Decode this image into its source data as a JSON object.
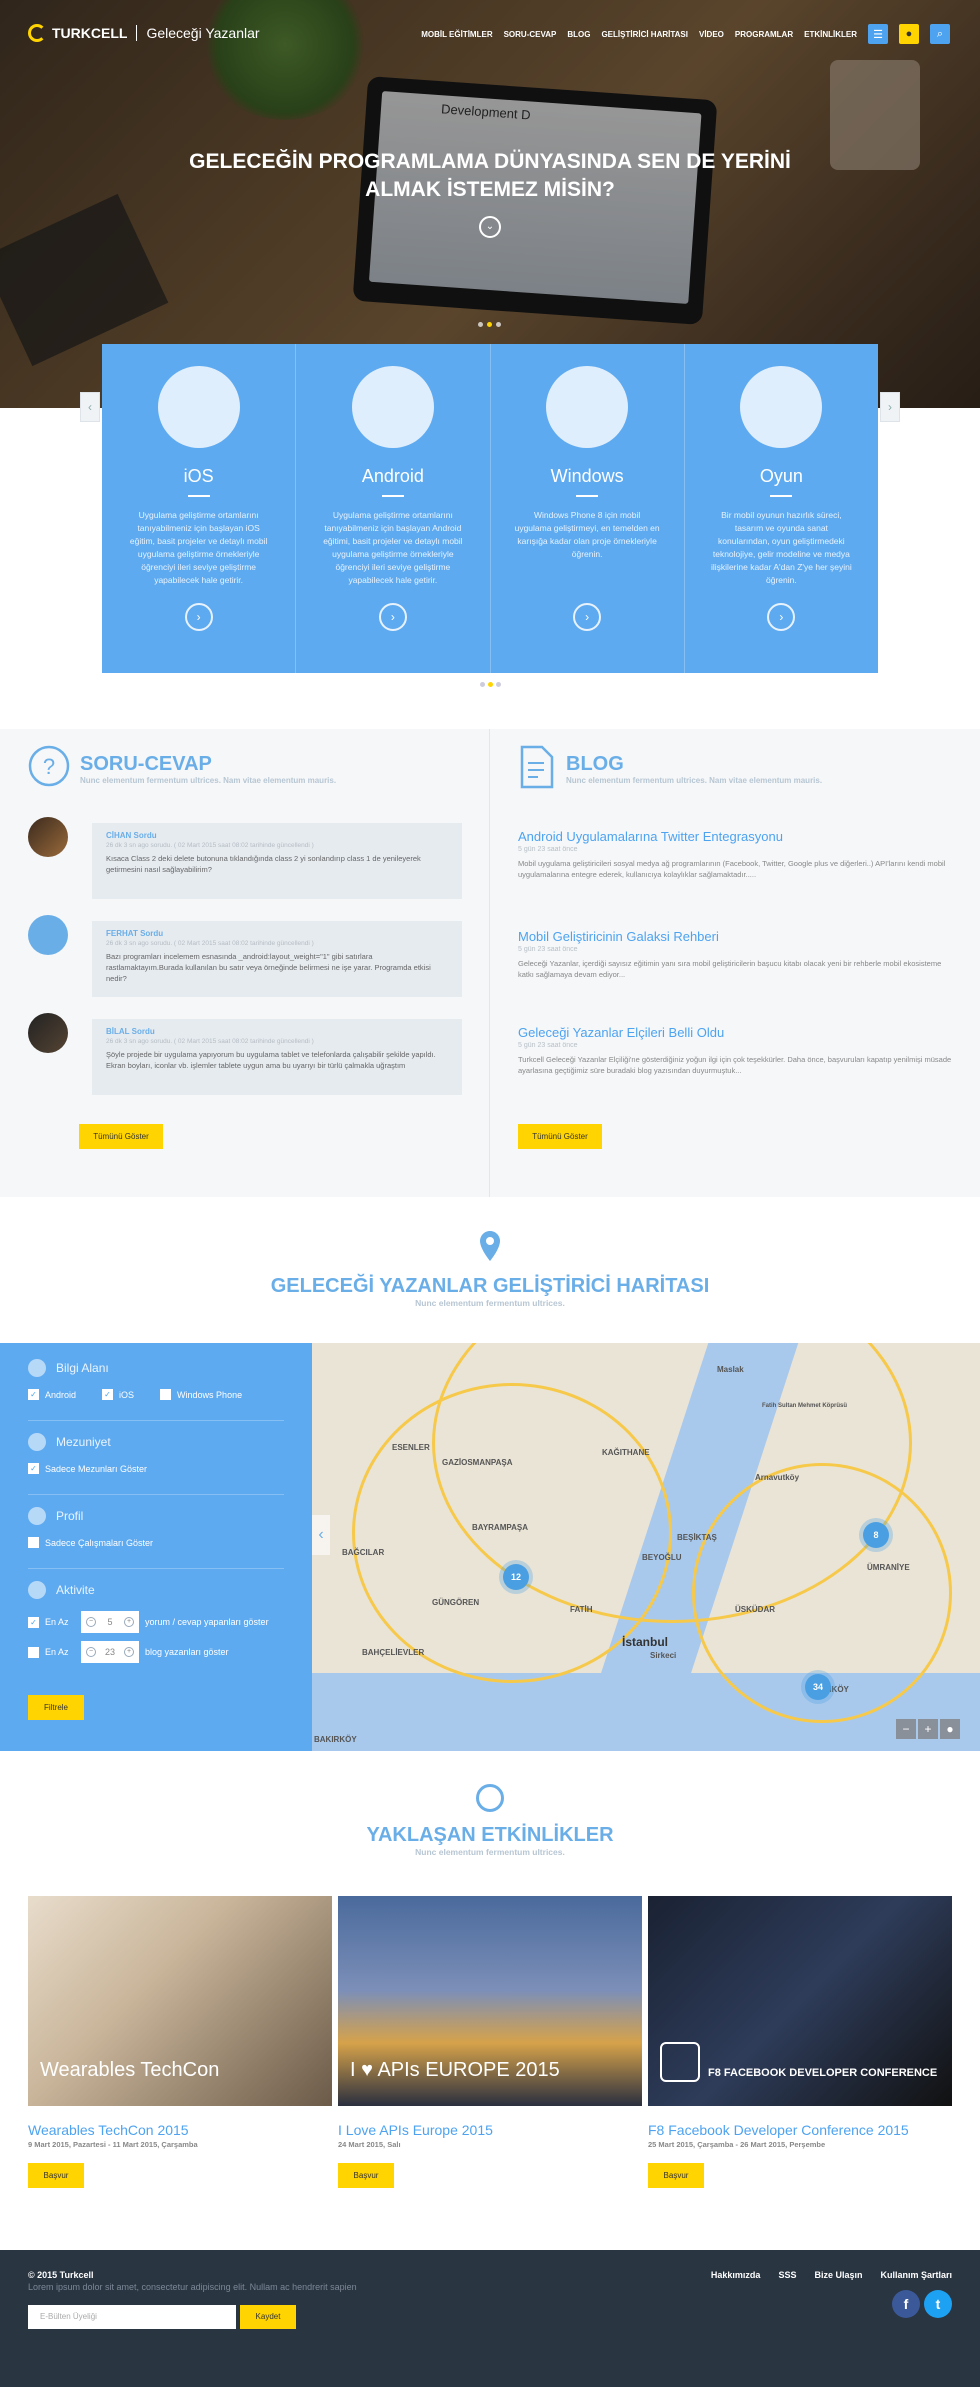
{
  "header": {
    "brand": "TURKCELL",
    "subtitle": "Geleceği Yazanlar",
    "nav": [
      "MOBİL EĞİTİMLER",
      "SORU-CEVAP",
      "BLOG",
      "GELİŞTİRİCİ HARİTASI",
      "VİDEO",
      "PROGRAMLAR",
      "ETKİNLİKLER"
    ]
  },
  "hero": {
    "title": "GELECEĞİN PROGRAMLAMA DÜNYASINDA SEN DE YERİNİ ALMAK İSTEMEZ MİSİN?",
    "screen_text": "Development D"
  },
  "categories": [
    {
      "name": "iOS",
      "icon": "apple-icon",
      "text": "Uygulama geliştirme ortamlarını tanıyabilmeniz için başlayan iOS eğitim, basit projeler ve detaylı mobil uygulama geliştirme örnekleriyle öğrenciyi ileri seviye geliştirme yapabilecek hale getirir."
    },
    {
      "name": "Android",
      "icon": "android-icon",
      "text": "Uygulama geliştirme ortamlarını tanıyabilmeniz için başlayan Android eğitimi, basit projeler ve detaylı mobil uygulama geliştirme örnekleriyle öğrenciyi ileri seviye geliştirme yapabilecek hale getirir."
    },
    {
      "name": "Windows",
      "icon": "windows-icon",
      "text": "Windows Phone 8 için mobil uygulama geliştirmeyi, en temelden en karışığa kadar olan proje örnekleriyle öğrenin."
    },
    {
      "name": "Oyun",
      "icon": "gamepad-icon",
      "text": "Bir mobil oyunun hazırlık süreci, tasarım ve oyunda sanat konularından, oyun geliştirmedeki teknolojiye, gelir modeline ve medya ilişkilerine kadar A'dan Z'ye her şeyini öğrenin."
    }
  ],
  "qa": {
    "title": "SORU-CEVAP",
    "subtitle": "Nunc elementum fermentum ultrices. Nam vitae elementum mauris.",
    "items": [
      {
        "name": "CİHAN Sordu",
        "time": "26 dk 3 sn ago sorudu. ( 02 Mart 2015 saat 08:02 tarihinde güncellendi )",
        "text": "Kısaca Class 2 deki delete butonuna tıklandığında class 2 yi sonlandırıp class 1 de yenileyerek getirmesini nasıl sağlayabilirim?"
      },
      {
        "name": "FERHAT Sordu",
        "time": "26 dk 3 sn ago sorudu. ( 02 Mart 2015 saat 08:02 tarihinde güncellendi )",
        "text": "Bazı programları incelemem esnasında _android:layout_weight=\"1\" gibi satırlara rastlamaktayım.Burada kullanılan bu satır veya örneğinde belirmesi ne işe yarar. Programda etkisi nedir?"
      },
      {
        "name": "BİLAL Sordu",
        "time": "26 dk 3 sn ago sorudu. ( 02 Mart 2015 saat 08:02 tarihinde güncellendi )",
        "text": "Şöyle projede bir uygulama yapıyorum bu uygulama tablet ve telefonlarda çalışabilir şekilde yapıldı. Ekran boyları, iconlar vb. işlemler tablete uygun ama bu uyarıyı bir türlü çalmakla uğraştım"
      }
    ],
    "button": "Tümünü Göster"
  },
  "blog": {
    "title": "BLOG",
    "subtitle": "Nunc elementum fermentum ultrices. Nam vitae elementum mauris.",
    "items": [
      {
        "title": "Android Uygulamalarına Twitter Entegrasyonu",
        "time": "5 gün 23 saat önce",
        "text": "Mobil uygulama geliştiricileri sosyal medya ağ programlarının (Facebook, Twitter, Google plus ve diğerleri..) API'larını kendi mobil uygulamalarına entegre ederek, kullanıcıya kolaylıklar sağlamaktadır....."
      },
      {
        "title": "Mobil Geliştiricinin Galaksi Rehberi",
        "time": "5 gün 23 saat önce",
        "text": "Geleceği Yazanlar, içerdiği sayısız eğitimin yanı sıra mobil geliştiricilerin başucu kitabı olacak yeni bir rehberle mobil ekosisteme katkı sağlamaya devam ediyor..."
      },
      {
        "title": "Geleceği Yazanlar Elçileri Belli Oldu",
        "time": "5 gün 23 saat önce",
        "text": "Turkcell Geleceği Yazanlar Elçiliği'ne gösterdiğiniz yoğun ilgi için çok teşekkürler. Daha önce, başvuruları kapatıp yenilmişi müsade ayarlasına geçtiğimiz süre buradaki blog yazısından duyurmuştuk..."
      }
    ],
    "button": "Tümünü Göster"
  },
  "map_section": {
    "title": "GELECEĞİ YAZANLAR GELİŞTİRİCİ HARİTASI",
    "subtitle": "Nunc elementum fermentum ultrices.",
    "filters": {
      "field_title": "Bilgi Alanı",
      "fields": [
        {
          "label": "Android",
          "checked": true
        },
        {
          "label": "iOS",
          "checked": true
        },
        {
          "label": "Windows Phone",
          "checked": false
        }
      ],
      "grad_title": "Mezuniyet",
      "grad_label": "Sadece Mezunları Göster",
      "profile_title": "Profil",
      "profile_label": "Sadece Çalışmaları Göster",
      "activity_title": "Aktivite",
      "activity": [
        {
          "label": "En Az",
          "value": "5",
          "suffix": "yorum / cevap yapanları göster"
        },
        {
          "label": "En Az",
          "value": "23",
          "suffix": "blog yazanları göster"
        }
      ],
      "button": "Filtrele"
    },
    "map_labels": [
      "Maslak",
      "Fatih Sultan Mehmet Köprüsü",
      "ESENLER",
      "GAZİOSMANPAŞA",
      "KAĞITHANE",
      "Arnavutköy",
      "BAĞCILAR",
      "BAYRAMPAŞA",
      "BEYOĞLU",
      "BEŞİKTAŞ",
      "ÜMRANİYE",
      "GÜNGÖREN",
      "FATİH",
      "ÜSKÜDAR",
      "BAHÇELİEVLER",
      "İstanbul",
      "Sirkeci",
      "KADIKÖY",
      "BAKIRKÖY"
    ],
    "clusters": [
      "12",
      "8",
      "34"
    ]
  },
  "events": {
    "title": "YAKLAŞAN ETKİNLİKLER",
    "subtitle": "Nunc elementum fermentum ultrices.",
    "items": [
      {
        "title": "Wearables TechCon 2015",
        "date": "9 Mart 2015, Pazartesi - 11 Mart 2015, Çarşamba",
        "caption": "Wearables TechCon",
        "button": "Başvur"
      },
      {
        "title": "I Love APIs Europe 2015",
        "date": "24 Mart 2015, Salı",
        "caption": "I ♥ APIs EUROPE 2015",
        "button": "Başvur"
      },
      {
        "title": "F8 Facebook Developer Conference 2015",
        "date": "25 Mart 2015, Çarşamba - 26 Mart 2015, Perşembe",
        "caption": "F8 FACEBOOK DEVELOPER CONFERENCE",
        "button": "Başvur"
      }
    ]
  },
  "footer": {
    "copy": "© 2015 Turkcell",
    "lorem": "Lorem ipsum dolor sit amet, consectetur adipiscing elit. Nullam ac hendrerit sapien",
    "links": [
      "Hakkımızda",
      "SSS",
      "Bize Ulaşın",
      "Kullanım Şartları"
    ],
    "newsletter_placeholder": "E-Bülten Üyeliği",
    "newsletter_button": "Kaydet"
  },
  "colors": {
    "accent": "#5eaaf0",
    "yellow": "#ffd400",
    "footer": "#2a3542"
  }
}
